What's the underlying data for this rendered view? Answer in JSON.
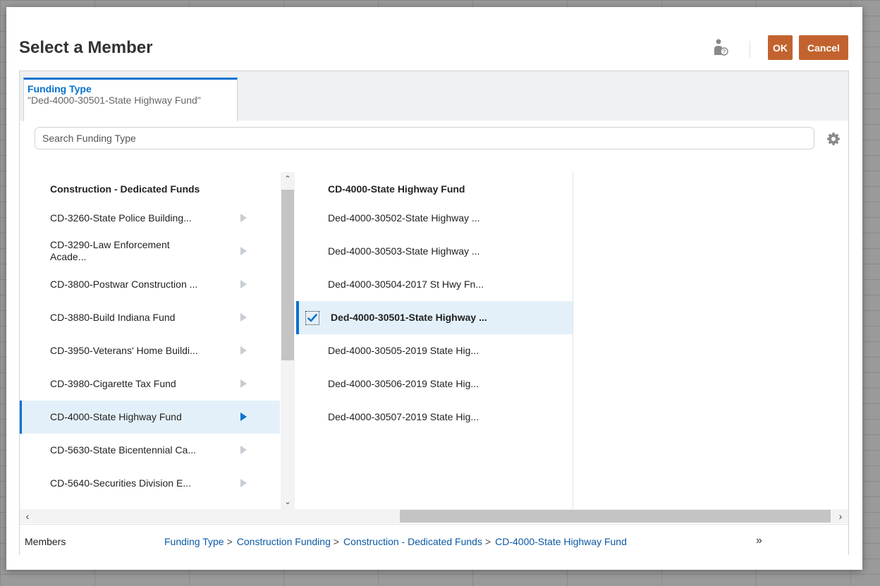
{
  "dialog": {
    "title": "Select a Member",
    "ok_label": "OK",
    "cancel_label": "Cancel"
  },
  "tab": {
    "title": "Funding Type",
    "value": "\"Ded-4000-30501-State Highway Fund\""
  },
  "search": {
    "placeholder": "Search Funding Type",
    "value": ""
  },
  "column1": {
    "header": "Construction - Dedicated Funds",
    "items": [
      {
        "label": "CD-3260-State Police Building...",
        "selected": false
      },
      {
        "label": "CD-3290-Law Enforcement Acade...",
        "selected": false
      },
      {
        "label": "CD-3800-Postwar Construction ...",
        "selected": false
      },
      {
        "label": "CD-3880-Build Indiana Fund",
        "selected": false
      },
      {
        "label": "CD-3950-Veterans' Home Buildi...",
        "selected": false
      },
      {
        "label": "CD-3980-Cigarette Tax Fund",
        "selected": false
      },
      {
        "label": "CD-4000-State Highway Fund",
        "selected": true
      },
      {
        "label": "CD-5630-State Bicentennial Ca...",
        "selected": false
      },
      {
        "label": "CD-5640-Securities Division E...",
        "selected": false
      }
    ]
  },
  "column2": {
    "header": "CD-4000-State Highway Fund",
    "items": [
      {
        "label": "Ded-4000-30502-State Highway ...",
        "selected": false
      },
      {
        "label": "Ded-4000-30503-State Highway ...",
        "selected": false
      },
      {
        "label": "Ded-4000-30504-2017 St Hwy Fn...",
        "selected": false
      },
      {
        "label": "Ded-4000-30501-State Highway ...",
        "selected": true
      },
      {
        "label": "Ded-4000-30505-2019 State Hig...",
        "selected": false
      },
      {
        "label": "Ded-4000-30506-2019 State Hig...",
        "selected": false
      },
      {
        "label": "Ded-4000-30507-2019 State Hig...",
        "selected": false
      }
    ]
  },
  "footer": {
    "members_label": "Members",
    "breadcrumb": [
      "Funding Type",
      "Construction Funding",
      "Construction - Dedicated Funds",
      "CD-4000-State Highway Fund"
    ],
    "separator": ">",
    "more": "»"
  },
  "icons": {
    "help": "user-help-icon",
    "settings": "gear-icon",
    "check": "checkmark-icon"
  },
  "colors": {
    "accent": "#0572ce",
    "button": "#c2632f",
    "selected_bg": "#e4f0f9",
    "link": "#0c5aa6"
  }
}
